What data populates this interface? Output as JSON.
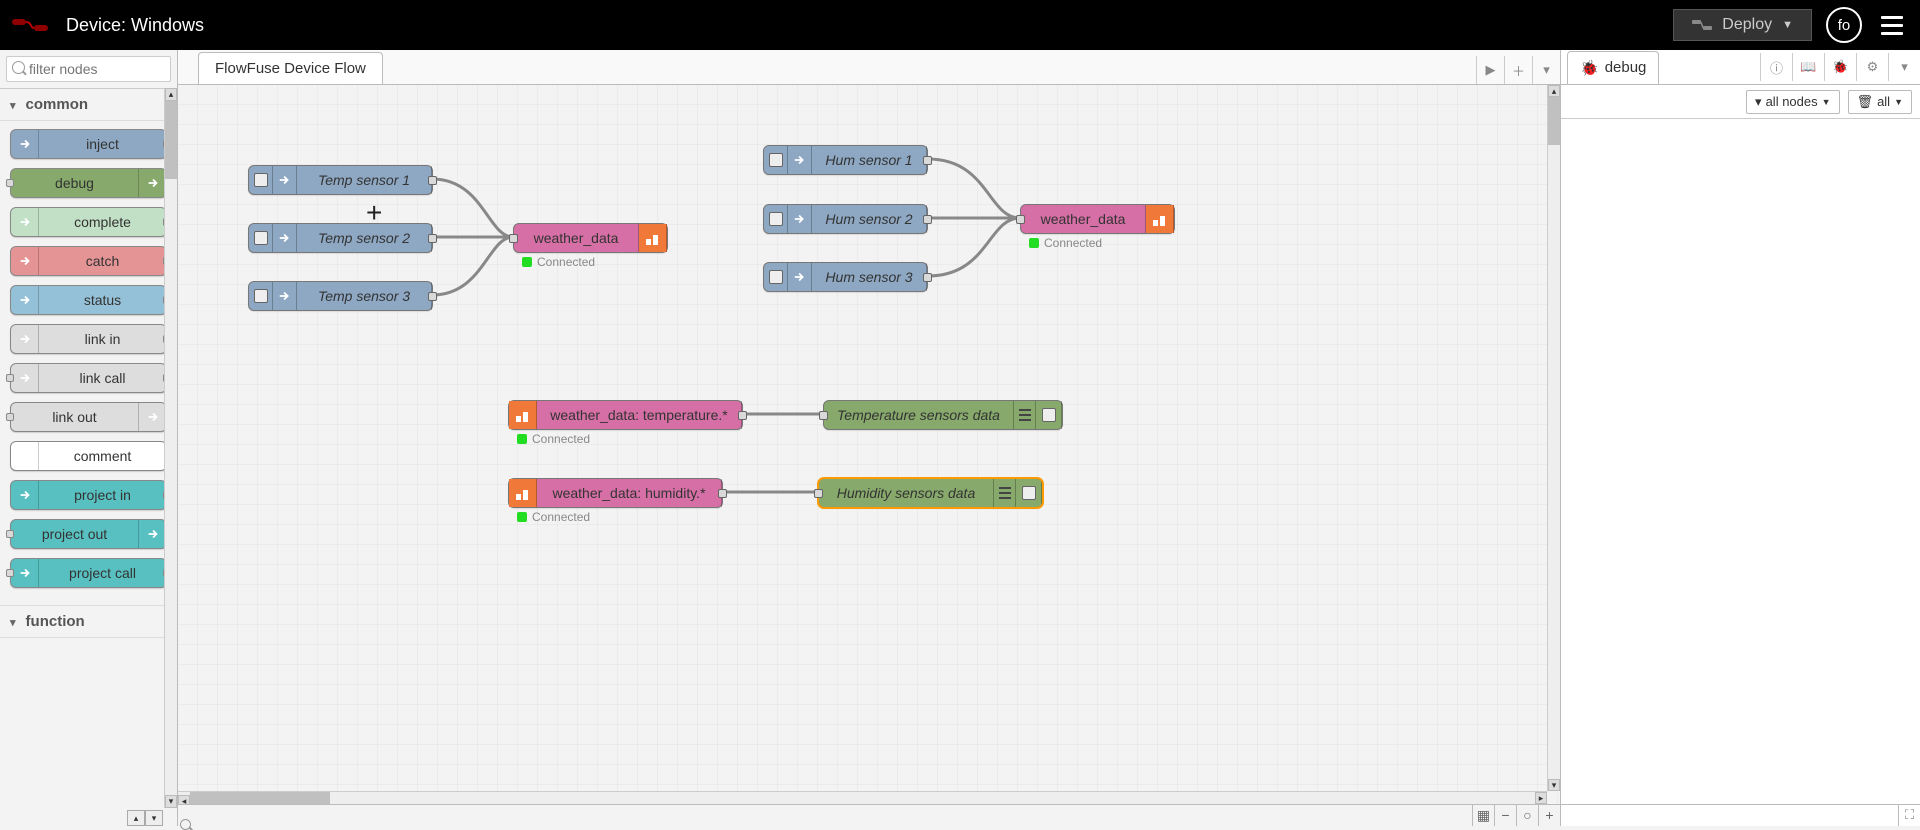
{
  "header": {
    "title": "Device: Windows",
    "deploy_label": "Deploy",
    "user_initials": "fo"
  },
  "palette": {
    "filter_placeholder": "filter nodes",
    "categories": [
      {
        "name": "common",
        "expanded": true
      },
      {
        "name": "function",
        "expanded": true
      }
    ],
    "items": [
      {
        "label": "inject",
        "color": "p-inject",
        "port_in": false,
        "port_out": true,
        "icon_side": "left"
      },
      {
        "label": "debug",
        "color": "p-debug",
        "port_in": true,
        "port_out": false,
        "icon_side": "right"
      },
      {
        "label": "complete",
        "color": "p-complete",
        "port_in": false,
        "port_out": true,
        "icon_side": "left"
      },
      {
        "label": "catch",
        "color": "p-catch",
        "port_in": false,
        "port_out": true,
        "icon_side": "left"
      },
      {
        "label": "status",
        "color": "p-status",
        "port_in": false,
        "port_out": true,
        "icon_side": "left"
      },
      {
        "label": "link in",
        "color": "p-link",
        "port_in": false,
        "port_out": true,
        "icon_side": "left"
      },
      {
        "label": "link call",
        "color": "p-link",
        "port_in": true,
        "port_out": true,
        "icon_side": "left"
      },
      {
        "label": "link out",
        "color": "p-link",
        "port_in": true,
        "port_out": false,
        "icon_side": "right"
      },
      {
        "label": "comment",
        "color": "p-comment",
        "port_in": false,
        "port_out": false,
        "icon_side": "left"
      },
      {
        "label": "project in",
        "color": "p-project",
        "port_in": false,
        "port_out": true,
        "icon_side": "left"
      },
      {
        "label": "project out",
        "color": "p-project",
        "port_in": true,
        "port_out": false,
        "icon_side": "right"
      },
      {
        "label": "project call",
        "color": "p-project",
        "port_in": true,
        "port_out": true,
        "icon_side": "left"
      }
    ]
  },
  "workspace": {
    "tab_label": "FlowFuse Device Flow",
    "status_connected": "Connected",
    "nodes": {
      "temp1": "Temp sensor 1",
      "temp2": "Temp sensor 2",
      "temp3": "Temp sensor 3",
      "hum1": "Hum sensor 1",
      "hum2": "Hum sensor 2",
      "hum3": "Hum sensor 3",
      "weather_out1": "weather_data",
      "weather_out2": "weather_data",
      "weather_in_temp": "weather_data: temperature.*",
      "weather_in_hum": "weather_data: humidity.*",
      "debug_temp": "Temperature sensors data",
      "debug_hum": "Humidity sensors data"
    }
  },
  "sidebar": {
    "debug_tab": "debug",
    "filter_all_nodes": "all nodes",
    "filter_all": "all"
  }
}
